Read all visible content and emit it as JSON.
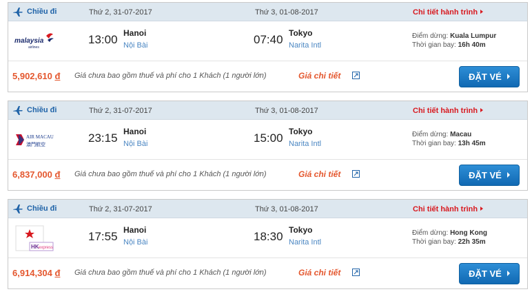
{
  "results": [
    {
      "direction": "Chiều đi",
      "depart_date": "Thứ 2, 31-07-2017",
      "arrive_date": "Thứ 3, 01-08-2017",
      "detail_link": "Chi tiết hành trình",
      "airline_logo": "malaysia-airlines-logo",
      "logo_text": "malaysia",
      "logo_subtext": "airlines",
      "depart_time": "13:00",
      "depart_city": "Hanoi",
      "depart_airport": "Nội Bài",
      "arrive_time": "07:40",
      "arrive_city": "Tokyo",
      "arrive_airport": "Narita Intl",
      "stop_label": "Điểm dừng:",
      "stop_value": "Kuala Lumpur",
      "duration_label": "Thời gian bay:",
      "duration_value": "16h 40m",
      "price": "5,902,610",
      "currency": "đ",
      "price_note": "Giá chưa bao gồm thuế và phí cho 1 Khách (1 người lớn)",
      "price_detail": "Giá chi tiết",
      "book_label": "ĐẶT VÉ"
    },
    {
      "direction": "Chiều đi",
      "depart_date": "Thứ 2, 31-07-2017",
      "arrive_date": "Thứ 3, 01-08-2017",
      "detail_link": "Chi tiết hành trình",
      "airline_logo": "air-macau-logo",
      "logo_text": "AIR MACAU",
      "logo_subtext": "澳門航空",
      "depart_time": "23:15",
      "depart_city": "Hanoi",
      "depart_airport": "Nội Bài",
      "arrive_time": "15:00",
      "arrive_city": "Tokyo",
      "arrive_airport": "Narita Intl",
      "stop_label": "Điểm dừng:",
      "stop_value": "Macau",
      "duration_label": "Thời gian bay:",
      "duration_value": "13h 45m",
      "price": "6,837,000",
      "currency": "đ",
      "price_note": "Giá chưa bao gồm thuế và phí cho 1 Khách (1 người lớn)",
      "price_detail": "Giá chi tiết",
      "book_label": "ĐẶT VÉ"
    },
    {
      "direction": "Chiều đi",
      "depart_date": "Thứ 2, 31-07-2017",
      "arrive_date": "Thứ 3, 01-08-2017",
      "detail_link": "Chi tiết hành trình",
      "airline_logo": "hk-express-logo",
      "logo_text": "HK",
      "logo_subtext": "express",
      "depart_time": "17:55",
      "depart_city": "Hanoi",
      "depart_airport": "Nội Bài",
      "arrive_time": "18:30",
      "arrive_city": "Tokyo",
      "arrive_airport": "Narita Intl",
      "stop_label": "Điểm dừng:",
      "stop_value": "Hong Kong",
      "duration_label": "Thời gian bay:",
      "duration_value": "22h 35m",
      "price": "6,914,304",
      "currency": "đ",
      "price_note": "Giá chưa bao gồm thuế và phí cho 1 Khách (1 người lớn)",
      "price_detail": "Giá chi tiết",
      "book_label": "ĐẶT VÉ"
    }
  ],
  "colors": {
    "header_bg": "#dde7ef",
    "link_red": "#d8191f",
    "price_orange": "#e4572e",
    "button_blue": "#1169b3"
  }
}
